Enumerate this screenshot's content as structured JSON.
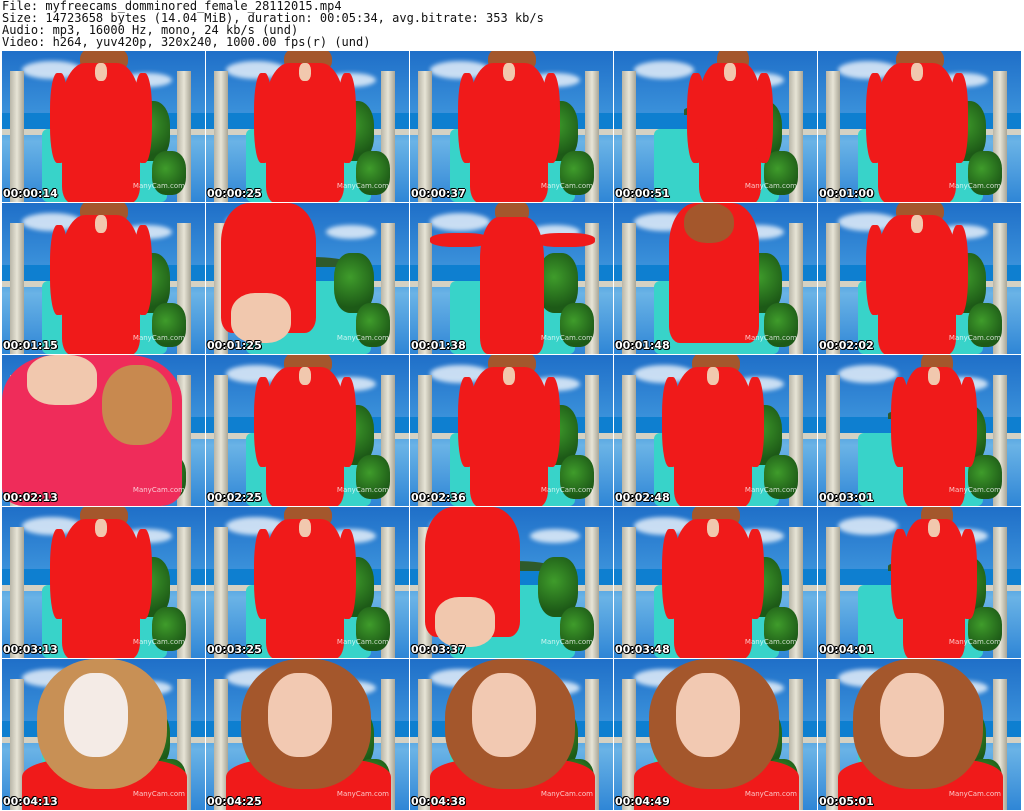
{
  "header": {
    "file_line": "File: myfreecams_domminored_female_28112015.mp4",
    "size_line": "Size: 14723658 bytes (14.04 MiB), duration: 00:05:34, avg.bitrate: 353 kb/s",
    "audio_line": "Audio: mp3, 16000 Hz, mono, 24 kb/s (und)",
    "video_line": "Video: h264, yuv420p, 320x240, 1000.00 fps(r) (und)"
  },
  "watermark": "ManyCam.com",
  "colors": {
    "shirt_red": "#f01a1a",
    "sky_blue": "#2f86d6",
    "sofa_teal": "#38d3c9",
    "hair_brown": "#a4572c"
  },
  "thumbnails": [
    {
      "time": "00:00:14",
      "scene": "full"
    },
    {
      "time": "00:00:25",
      "scene": "full"
    },
    {
      "time": "00:00:37",
      "scene": "full"
    },
    {
      "time": "00:00:51",
      "scene": "full-far"
    },
    {
      "time": "00:01:00",
      "scene": "full"
    },
    {
      "time": "00:01:15",
      "scene": "full"
    },
    {
      "time": "00:01:25",
      "scene": "side"
    },
    {
      "time": "00:01:38",
      "scene": "arms-out"
    },
    {
      "time": "00:01:48",
      "scene": "arms-up"
    },
    {
      "time": "00:02:02",
      "scene": "full"
    },
    {
      "time": "00:02:13",
      "scene": "closeup-pink"
    },
    {
      "time": "00:02:25",
      "scene": "full"
    },
    {
      "time": "00:02:36",
      "scene": "full"
    },
    {
      "time": "00:02:48",
      "scene": "full"
    },
    {
      "time": "00:03:01",
      "scene": "full-far"
    },
    {
      "time": "00:03:13",
      "scene": "full"
    },
    {
      "time": "00:03:25",
      "scene": "full"
    },
    {
      "time": "00:03:37",
      "scene": "side"
    },
    {
      "time": "00:03:48",
      "scene": "full"
    },
    {
      "time": "00:04:01",
      "scene": "full-far"
    },
    {
      "time": "00:04:13",
      "scene": "face-blur"
    },
    {
      "time": "00:04:25",
      "scene": "face"
    },
    {
      "time": "00:04:38",
      "scene": "face"
    },
    {
      "time": "00:04:49",
      "scene": "face"
    },
    {
      "time": "00:05:01",
      "scene": "face-profile"
    }
  ]
}
